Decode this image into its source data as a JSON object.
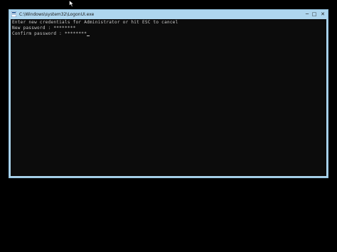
{
  "window": {
    "title": "C:\\Windows\\system32\\LogonUI.exe",
    "controls": {
      "minimize": "─",
      "maximize": "□",
      "close": "✕"
    }
  },
  "console": {
    "lines": [
      "Enter new credentials for Administrator or hit ESC to cancel",
      "New password : ********",
      "Confirm password : ********"
    ]
  },
  "icons": {
    "app": "console-app-icon",
    "pointer": "mouse-pointer-icon"
  },
  "colors": {
    "titlebar": "#aed6ee",
    "console_bg": "#0c0c0c",
    "console_text": "#cccccc",
    "desktop": "#000000"
  }
}
